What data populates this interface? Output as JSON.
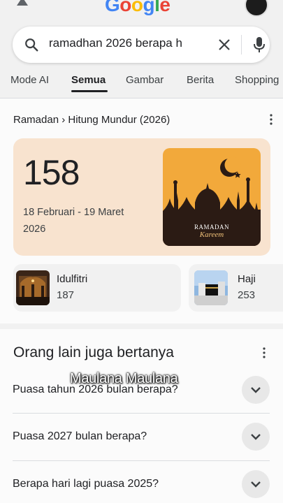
{
  "header": {
    "logo_letters": [
      "G",
      "o",
      "o",
      "g",
      "l",
      "e"
    ]
  },
  "search": {
    "query": "ramadhan 2026 berapa h"
  },
  "tabs": [
    {
      "label": "Mode AI"
    },
    {
      "label": "Semua"
    },
    {
      "label": "Gambar"
    },
    {
      "label": "Berita"
    },
    {
      "label": "Shopping"
    }
  ],
  "active_tab": "Semua",
  "result": {
    "breadcrumb": "Ramadan › Hitung Mundur (2026)",
    "countdown": {
      "days": "158",
      "dates": "18 Februari - 19 Maret 2026"
    },
    "image_caption": {
      "line1": "RAMADAN",
      "line2": "Kareem"
    },
    "related": [
      {
        "title": "Idulfitri",
        "days": "187"
      },
      {
        "title": "Haji",
        "days": "253"
      }
    ]
  },
  "paa": {
    "heading": "Orang lain juga bertanya",
    "watermark": "Maulana Maulana",
    "questions": [
      "Puasa tahun 2026 bulan berapa?",
      "Puasa 2027 bulan berapa?",
      "Berapa hari lagi puasa 2025?"
    ]
  },
  "colors": {
    "countdown_bg": "#f8e3cf",
    "image_bg": "#f2a93b",
    "mosque": "#2b1b14"
  }
}
